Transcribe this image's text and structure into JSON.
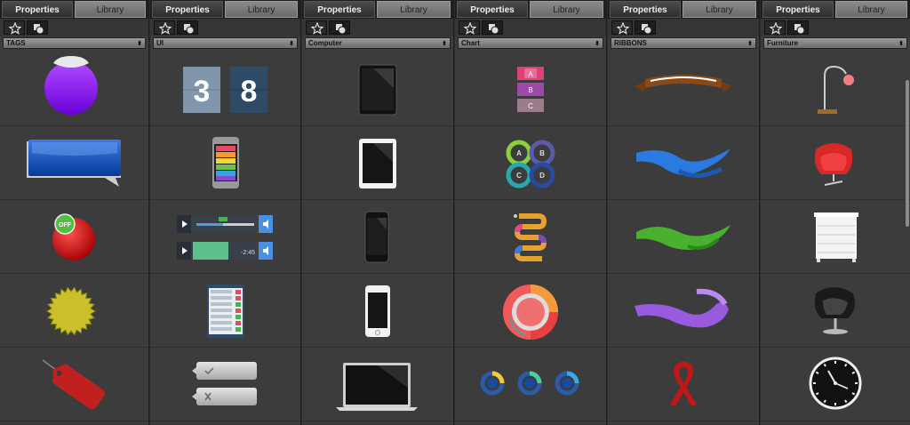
{
  "panels": [
    {
      "properties_tab": "Properties",
      "library_tab": "Library",
      "category": "TAGS",
      "items": [
        "purple-circle-tag",
        "blue-speech-bubble",
        "red-off-button",
        "yellow-starburst-seal",
        "red-luggage-tag"
      ]
    },
    {
      "properties_tab": "Properties",
      "library_tab": "Library",
      "category": "UI",
      "items": [
        "flip-counter",
        "smartphone-app-list",
        "media-player-sliders",
        "settings-list-panel",
        "gray-buttons"
      ]
    },
    {
      "properties_tab": "Properties",
      "library_tab": "Library",
      "category": "Computer",
      "items": [
        "black-tablet",
        "white-tablet",
        "black-smartphone",
        "white-smartphone",
        "laptop"
      ]
    },
    {
      "properties_tab": "Properties",
      "library_tab": "Library",
      "category": "Chart",
      "items": [
        "abc-stacked-labels",
        "abcd-circle-diagram",
        "snake-timeline",
        "donut-chart",
        "icon-progress-rings"
      ],
      "abc_labels": [
        "A",
        "B",
        "C"
      ],
      "abcd_labels": [
        "A",
        "B",
        "C",
        "D"
      ]
    },
    {
      "properties_tab": "Properties",
      "library_tab": "Library",
      "category": "RIBBONS",
      "items": [
        "brown-banner-ribbon",
        "blue-wavy-ribbon",
        "green-wavy-ribbon",
        "purple-wavy-ribbon",
        "red-awareness-ribbon"
      ]
    },
    {
      "properties_tab": "Properties",
      "library_tab": "Library",
      "category": "Furniture",
      "items": [
        "floor-lamp",
        "red-egg-chair",
        "white-dresser",
        "black-swivel-chair",
        "wall-clock"
      ]
    }
  ],
  "flip_counter": [
    "3",
    "8"
  ],
  "off_button_label": "OFF",
  "media_readout": "-2:45"
}
